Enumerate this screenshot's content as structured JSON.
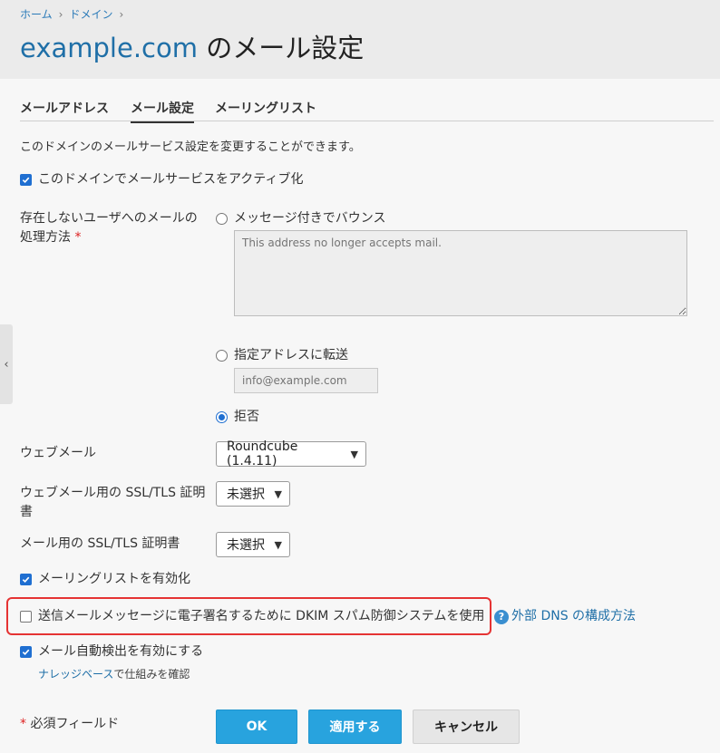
{
  "breadcrumb": {
    "home": "ホーム",
    "domains": "ドメイン",
    "sep": "›"
  },
  "title": {
    "domain": "example.com",
    "suffix": " のメール設定"
  },
  "tabs": [
    {
      "label": "メールアドレス",
      "active": false
    },
    {
      "label": "メール設定",
      "active": true
    },
    {
      "label": "メーリングリスト",
      "active": false
    }
  ],
  "description": "このドメインのメールサービス設定を変更することができます。",
  "activate_mail": {
    "label": "このドメインでメールサービスをアクティブ化",
    "checked": true
  },
  "nonexistent": {
    "label_line1": "存在しないユーザへのメールの",
    "label_line2": "処理方法",
    "required_mark": "*",
    "options": {
      "bounce": {
        "label": "メッセージ付きでバウンス",
        "checked": false,
        "placeholder": "This address no longer accepts mail."
      },
      "forward": {
        "label": "指定アドレスに転送",
        "checked": false,
        "placeholder": "info@example.com"
      },
      "reject": {
        "label": "拒否",
        "checked": true
      }
    }
  },
  "webmail": {
    "label": "ウェブメール",
    "value": "Roundcube (1.4.11)"
  },
  "webmail_ssl": {
    "label_line1": "ウェブメール用の SSL/TLS 証明",
    "label_line2": "書",
    "value": "未選択"
  },
  "mail_ssl": {
    "label": "メール用の SSL/TLS 証明書",
    "value": "未選択"
  },
  "mailing_list": {
    "label": "メーリングリストを有効化",
    "checked": true
  },
  "dkim": {
    "label": "送信メールメッセージに電子署名するために DKIM スパム防御システムを使用",
    "checked": false,
    "help_icon": "?",
    "help_link": "外部 DNS の構成方法"
  },
  "autodiscover": {
    "label": "メール自動検出を有効にする",
    "checked": true,
    "kb_link": "ナレッジベース",
    "kb_suffix": "で仕組みを確認"
  },
  "required_note": {
    "mark": "*",
    "text": " 必須フィールド"
  },
  "buttons": {
    "ok": "OK",
    "apply": "適用する",
    "cancel": "キャンセル"
  },
  "icons": {
    "sidebar_toggle": "chevron-left-icon",
    "select_caret": "chevron-down-icon",
    "help": "question-circle-icon"
  },
  "colors": {
    "accent": "#28a3de",
    "link": "#1f6fa7",
    "checkbox": "#1f6fd1",
    "highlight": "#e53333"
  }
}
